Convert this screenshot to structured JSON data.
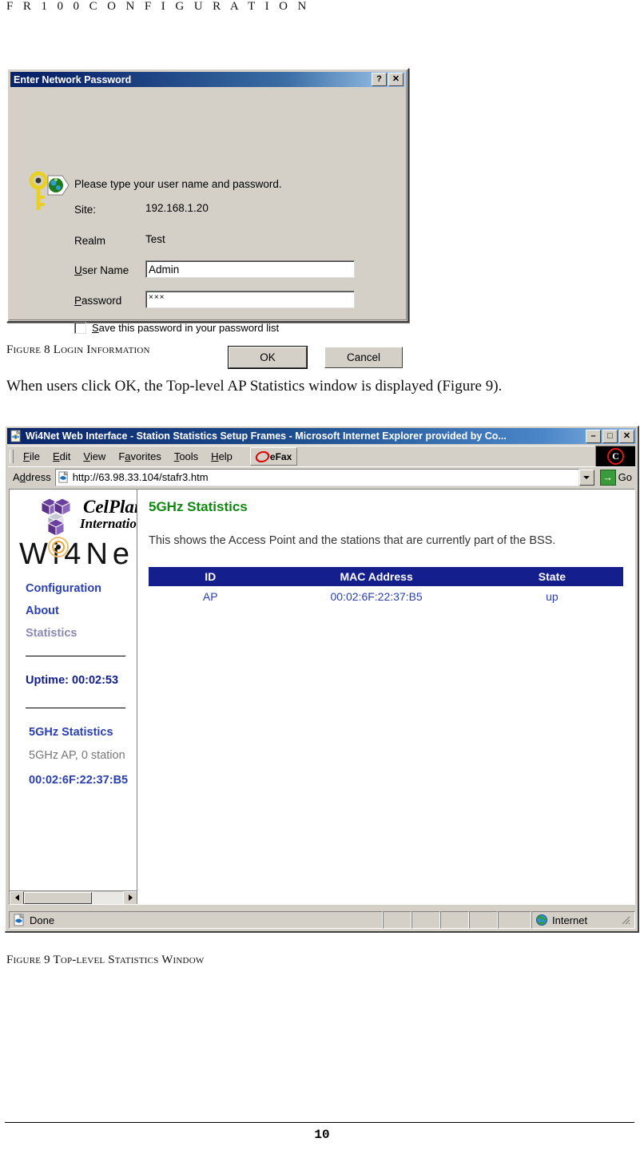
{
  "document": {
    "running_head": "F R   1 0 0   C O N F I G U R A T I O N",
    "page_number": "10",
    "body_paragraph": "When users click OK, the Top-level AP Statistics window is displayed (Figure 9).",
    "figure8_caption": "Figure 8 Login Information",
    "figure9_caption": "Figure 9 Top-level Statistics Window"
  },
  "login_dialog": {
    "title": "Enter Network Password",
    "help_button": "?",
    "close_button": "✕",
    "prompt": "Please type your user name and password.",
    "site_label": "Site:",
    "site_value": "192.168.1.20",
    "realm_label": "Realm",
    "realm_value": "Test",
    "username_label": "User Name",
    "username_value": "Admin",
    "password_label": "Password",
    "password_value": "×××",
    "save_checkbox_label": "Save this password in your password list",
    "ok_button": "OK",
    "cancel_button": "Cancel"
  },
  "browser": {
    "window_title": "Wi4Net Web Interface - Station Statistics Setup Frames - Microsoft Internet Explorer provided by Co...",
    "minimize_label": "–",
    "maximize_label": "□",
    "close_label": "✕",
    "menu": [
      "File",
      "Edit",
      "View",
      "Favorites",
      "Tools",
      "Help"
    ],
    "toolbar_button": "eFax",
    "brand_logo_letter": "C",
    "address_label": "Address",
    "address_value": "http://63.98.33.104/stafr3.htm",
    "go_label": "Go",
    "go_arrow": "→",
    "status": {
      "text": "Done",
      "zone": "Internet"
    }
  },
  "sidebar": {
    "logo_brand": "CelPlan",
    "logo_brand_sub": "International",
    "logo_product": "Wi4Ne",
    "nav": [
      {
        "label": "Configuration",
        "state": "link"
      },
      {
        "label": "About",
        "state": "link"
      },
      {
        "label": "Statistics",
        "state": "visited"
      }
    ],
    "uptime": "Uptime: 00:02:53",
    "section_heading": "5GHz Statistics",
    "section_sub": "5GHz AP, 0 station",
    "mac_link": "00:02:6F:22:37:B5"
  },
  "content": {
    "heading": "5GHz Statistics",
    "description": "This shows the Access Point and the stations that are currently part of the BSS.",
    "table": {
      "headers": [
        "ID",
        "MAC Address",
        "State"
      ],
      "rows": [
        {
          "id": "AP",
          "mac": "00:02:6F:22:37:B5",
          "state": "up"
        }
      ]
    }
  },
  "colors": {
    "title_blue": "#0a246a",
    "heading_green": "#118811",
    "table_header_blue": "#141e8c",
    "link_blue": "#2a3fb0",
    "chrome_gray": "#d4d0c8"
  }
}
